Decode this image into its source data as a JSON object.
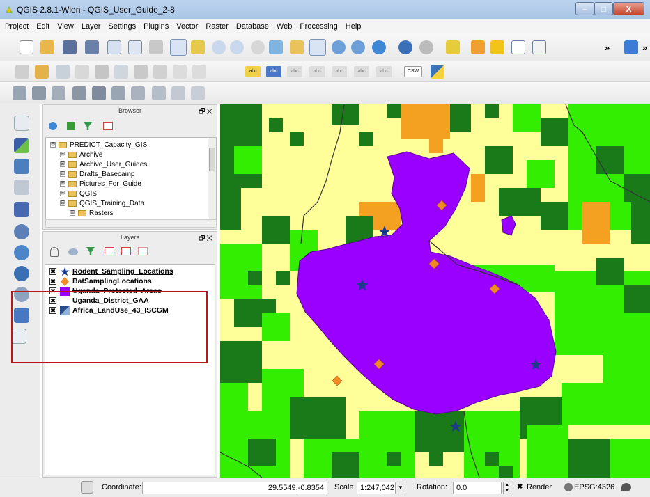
{
  "window": {
    "title": "QGIS 2.8.1-Wien - QGIS_User_Guide_2-8",
    "min_glyph": "–",
    "max_glyph": "□",
    "close_glyph": "X"
  },
  "menus": [
    "Project",
    "Edit",
    "View",
    "Layer",
    "Settings",
    "Plugins",
    "Vector",
    "Raster",
    "Database",
    "Web",
    "Processing",
    "Help"
  ],
  "toolbar": {
    "overflow_glyph": "»",
    "label_text": "abc",
    "csw": "CSW"
  },
  "browser": {
    "title": "Browser",
    "window_btns": "🗗✕",
    "items": [
      {
        "label": "PREDICT_Capacity_GIS",
        "level": 0,
        "expand": "⊟"
      },
      {
        "label": "Archive",
        "level": 1,
        "expand": "⊞"
      },
      {
        "label": "Archive_User_Guides",
        "level": 1,
        "expand": "⊞"
      },
      {
        "label": "Drafts_Basecamp",
        "level": 1,
        "expand": "⊞"
      },
      {
        "label": "Pictures_For_Guide",
        "level": 1,
        "expand": "⊞"
      },
      {
        "label": "QGIS",
        "level": 1,
        "expand": "⊞"
      },
      {
        "label": "QGIS_Training_Data",
        "level": 1,
        "expand": "⊟"
      },
      {
        "label": "Rasters",
        "level": 2,
        "expand": "⊞"
      }
    ]
  },
  "layers": {
    "title": "Layers",
    "window_btns": "🗗✕",
    "items": [
      {
        "label": "Rodent_Sampling_Locations",
        "checked": "✖",
        "symbol": "star",
        "style": "underline"
      },
      {
        "label": "BatSamplingLocations",
        "checked": "✖",
        "symbol": "diamond",
        "style": "normal"
      },
      {
        "label": "Uganda_Protected_Areas",
        "checked": "✖",
        "symbol": "purple-fill",
        "style": "strike"
      },
      {
        "label": "Uganda_District_GAA",
        "checked": "✖",
        "symbol": "none",
        "style": "normal"
      },
      {
        "label": "Africa_LandUse_43_ISCGM",
        "checked": "✖",
        "symbol": "raster",
        "style": "normal"
      }
    ]
  },
  "status": {
    "coordinate_label": "Coordinate:",
    "coordinate_value": "29.5549,-0.8354",
    "scale_label": "Scale",
    "scale_value": "1:247,042",
    "rotation_label": "Rotation:",
    "rotation_value": "0.0",
    "render_label": "Render",
    "render_check": "✖",
    "crs": "EPSG:4326"
  },
  "colors": {
    "landuse_yellow": "#ffff99",
    "landuse_light_green": "#33ee00",
    "landuse_dark_green": "#1a7a1a",
    "landuse_orange": "#f4a020",
    "protected_area": "#9900ff",
    "district_line": "#333333",
    "rodent_star": "#1a3a8c",
    "bat_diamond": "#f08a24",
    "highlight_box": "#c0141b"
  }
}
